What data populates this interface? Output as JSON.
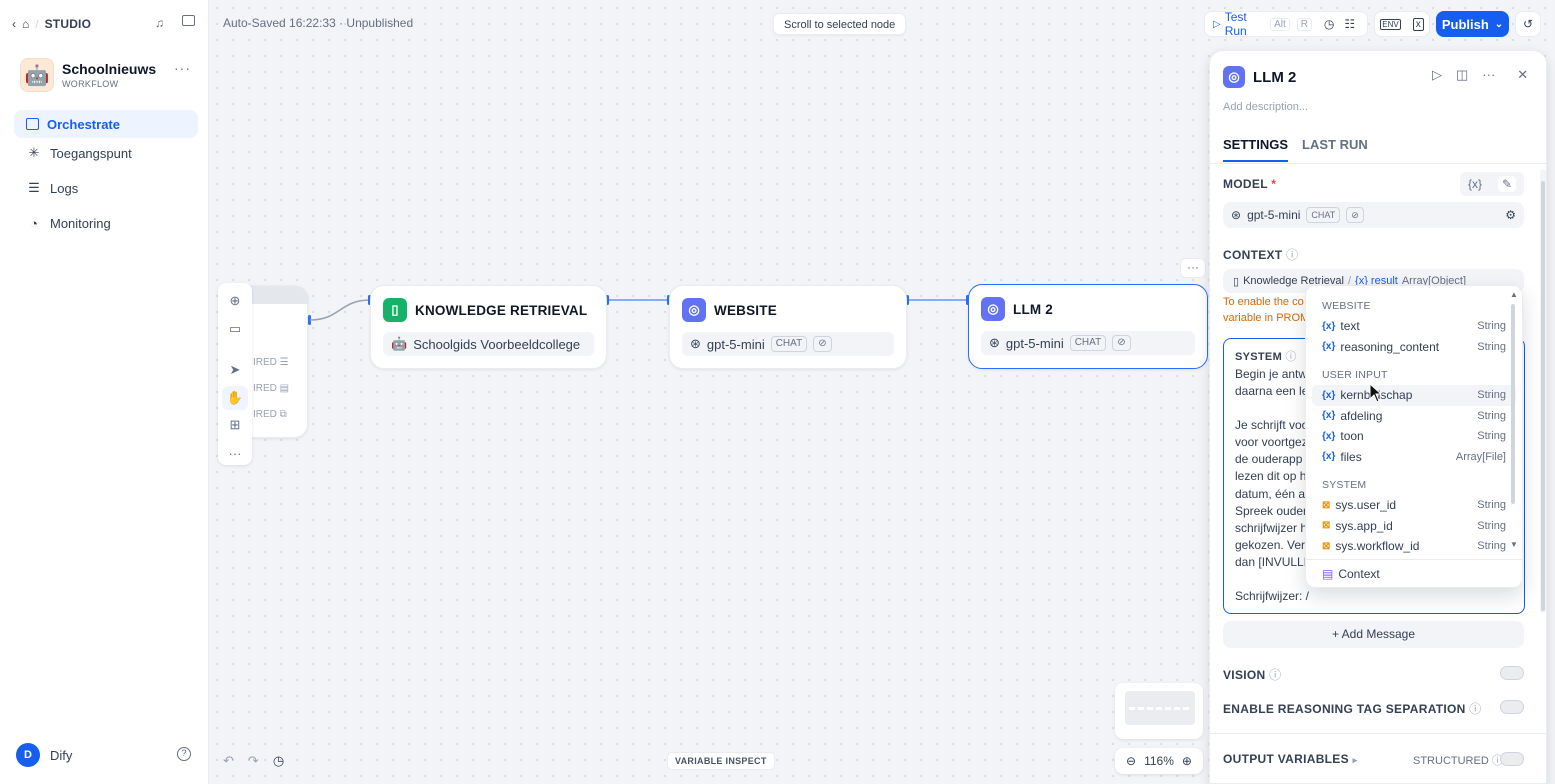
{
  "sidebar": {
    "crumb": "STUDIO",
    "app_name": "Schoolnieuws",
    "app_type": "WORKFLOW",
    "app_emoji": "🤖",
    "nav": [
      {
        "label": "Orchestrate",
        "active": true
      },
      {
        "label": "Toegangspunt"
      },
      {
        "label": "Logs"
      },
      {
        "label": "Monitoring"
      }
    ],
    "user_initial": "D",
    "user_name": "Dify"
  },
  "topbar": {
    "status": "Auto-Saved 16:22:33 · Unpublished",
    "scroll_button": "Scroll to selected node",
    "test_run": "Test Run",
    "kbd1": "Alt",
    "kbd2": "R",
    "publish": "Publish"
  },
  "canvas": {
    "start_rows": [
      "IRED",
      "IRED",
      "IRED"
    ],
    "nodes": [
      {
        "title": "KNOWLEDGE RETRIEVAL",
        "body": "Schoolgids Voorbeeldcollege",
        "body_emoji": "🤖"
      },
      {
        "title": "WEBSITE",
        "model": "gpt-5-mini",
        "badge": "CHAT"
      },
      {
        "title": "LLM 2",
        "model": "gpt-5-mini",
        "badge": "CHAT"
      }
    ],
    "variable_inspect": "VARIABLE INSPECT",
    "zoom": "116%"
  },
  "panel": {
    "title": "LLM 2",
    "description_placeholder": "Add description...",
    "tabs": [
      "SETTINGS",
      "LAST RUN"
    ],
    "model_label": "MODEL",
    "model_name": "gpt-5-mini",
    "model_badge": "CHAT",
    "context_label": "CONTEXT",
    "context_value": "Knowledge Retrieval",
    "context_var": "{x} result",
    "context_type": "Array[Object]",
    "context_warning_1": "To enable the co",
    "context_warning_2": "variable in PROM",
    "system_label": "SYSTEM",
    "system_lines": [
      "Begin je antw",
      "daarna een le",
      "",
      "Je schrijft voo",
      "voor voortgez",
      "de ouderapp",
      "lezen dit op h",
      "datum, één a",
      "Spreek ouder",
      "schrijfwijzer h",
      "gekozen. Ver",
      "dan [INVULLE",
      "",
      "Schrijfwijzer: /"
    ],
    "add_message": "+ Add Message",
    "vision": "VISION",
    "reasoning": "ENABLE REASONING TAG SEPARATION",
    "output_vars": "OUTPUT VARIABLES",
    "structured": "STRUCTURED"
  },
  "dropdown": {
    "groups": [
      {
        "name": "WEBSITE",
        "items": [
          {
            "name": "text",
            "type": "String"
          },
          {
            "name": "reasoning_content",
            "type": "String"
          }
        ]
      },
      {
        "name": "USER INPUT",
        "items": [
          {
            "name": "kernb  dschap",
            "type": "String",
            "highlight": true
          },
          {
            "name": "afdeling",
            "type": "String"
          },
          {
            "name": "toon",
            "type": "String"
          },
          {
            "name": "files",
            "type": "Array[File]"
          }
        ]
      },
      {
        "name": "SYSTEM",
        "items": [
          {
            "name": "sys.user_id",
            "type": "String",
            "sys": true
          },
          {
            "name": "sys.app_id",
            "type": "String",
            "sys": true
          },
          {
            "name": "sys.workflow_id",
            "type": "String",
            "sys": true
          }
        ]
      }
    ],
    "context_item": "Context"
  },
  "colors": {
    "accent": "#155eef",
    "kr_icon": "#17b26a",
    "llm_icon": "#6172f3",
    "warning": "#dc6803"
  }
}
